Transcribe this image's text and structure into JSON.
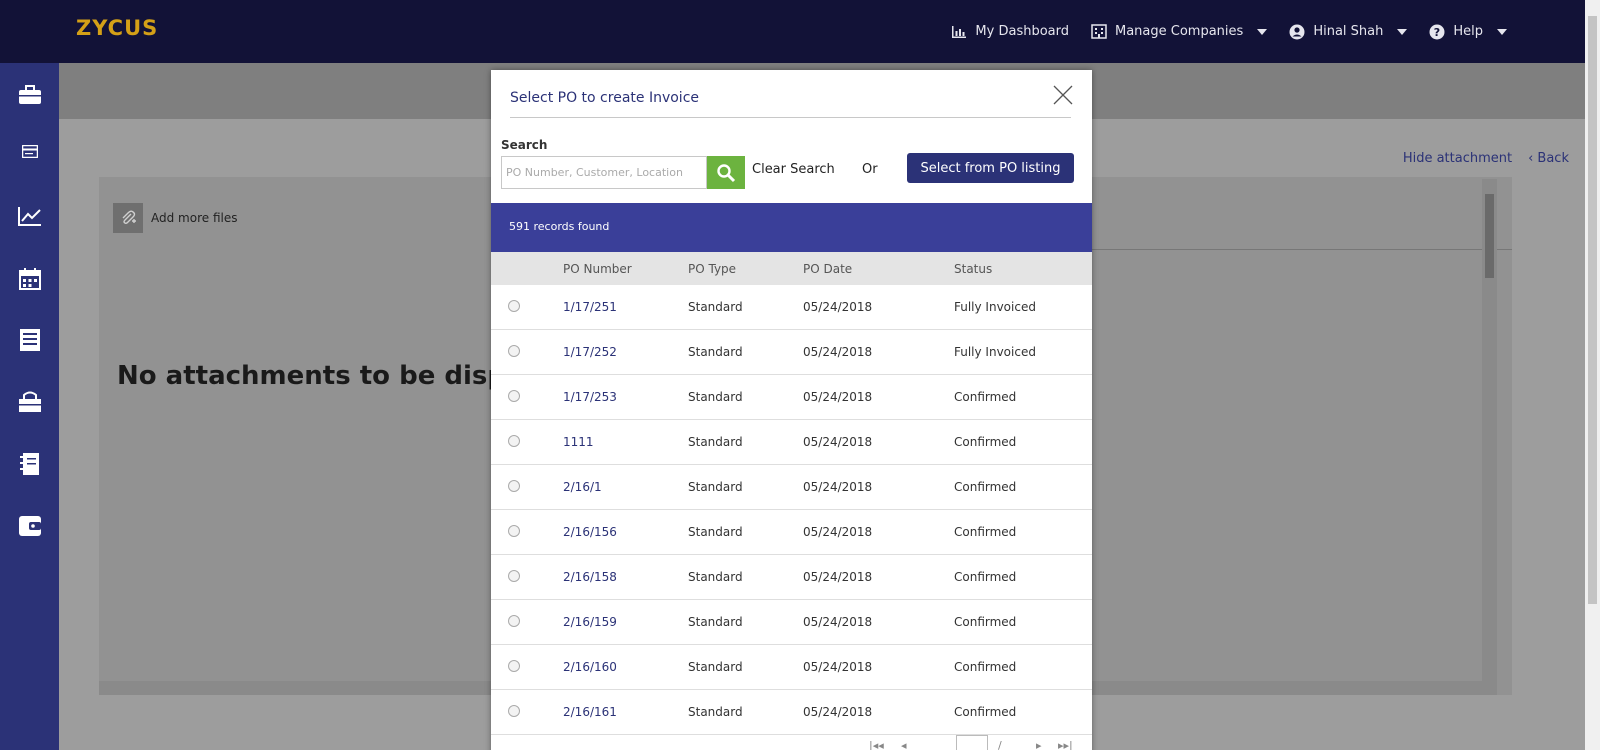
{
  "topbar": {
    "logo": "ZYCUS",
    "nav": [
      {
        "label": "My Dashboard",
        "icon": "bar-chart-icon",
        "dropdown": false
      },
      {
        "label": "Manage Companies",
        "icon": "building-icon",
        "dropdown": true
      },
      {
        "label": "Hinal Shah",
        "icon": "user-icon",
        "dropdown": true
      },
      {
        "label": "Help",
        "icon": "help-icon",
        "dropdown": true
      }
    ]
  },
  "sidebar": {
    "items": [
      "briefcase-icon",
      "card-icon",
      "trend-chart-icon",
      "calendar-icon",
      "receipt-icon",
      "shopping-bag-icon",
      "notebook-icon",
      "wallet-icon"
    ]
  },
  "main": {
    "hide_attachment": "Hide attachment",
    "back": "‹ Back",
    "add_more_files": "Add more files",
    "no_attachments": "No attachments to be displ"
  },
  "modal": {
    "title": "Select PO to create Invoice",
    "search_label": "Search",
    "search_placeholder": "PO Number, Customer, Location",
    "clear_search": "Clear Search",
    "or": "Or",
    "select_from_listing": "Select from PO listing",
    "records_found": "591 records found",
    "columns": [
      "PO Number",
      "PO Type",
      "PO Date",
      "Status"
    ],
    "rows": [
      {
        "po": "1/17/251",
        "type": "Standard",
        "date": "05/24/2018",
        "status": "Fully Invoiced"
      },
      {
        "po": "1/17/252",
        "type": "Standard",
        "date": "05/24/2018",
        "status": "Fully Invoiced"
      },
      {
        "po": "1/17/253",
        "type": "Standard",
        "date": "05/24/2018",
        "status": "Confirmed"
      },
      {
        "po": "1111",
        "type": "Standard",
        "date": "05/24/2018",
        "status": "Confirmed"
      },
      {
        "po": "2/16/1",
        "type": "Standard",
        "date": "05/24/2018",
        "status": "Confirmed"
      },
      {
        "po": "2/16/156",
        "type": "Standard",
        "date": "05/24/2018",
        "status": "Confirmed"
      },
      {
        "po": "2/16/158",
        "type": "Standard",
        "date": "05/24/2018",
        "status": "Confirmed"
      },
      {
        "po": "2/16/159",
        "type": "Standard",
        "date": "05/24/2018",
        "status": "Confirmed"
      },
      {
        "po": "2/16/160",
        "type": "Standard",
        "date": "05/24/2018",
        "status": "Confirmed"
      },
      {
        "po": "2/16/161",
        "type": "Standard",
        "date": "05/24/2018",
        "status": "Confirmed"
      }
    ]
  },
  "colors": {
    "topbar": "#121237",
    "sidebar": "#2b3277",
    "accent": "#2b3277",
    "records_bar": "#3a3f99",
    "search_button": "#6cb33f",
    "logo": "#d4a017"
  }
}
